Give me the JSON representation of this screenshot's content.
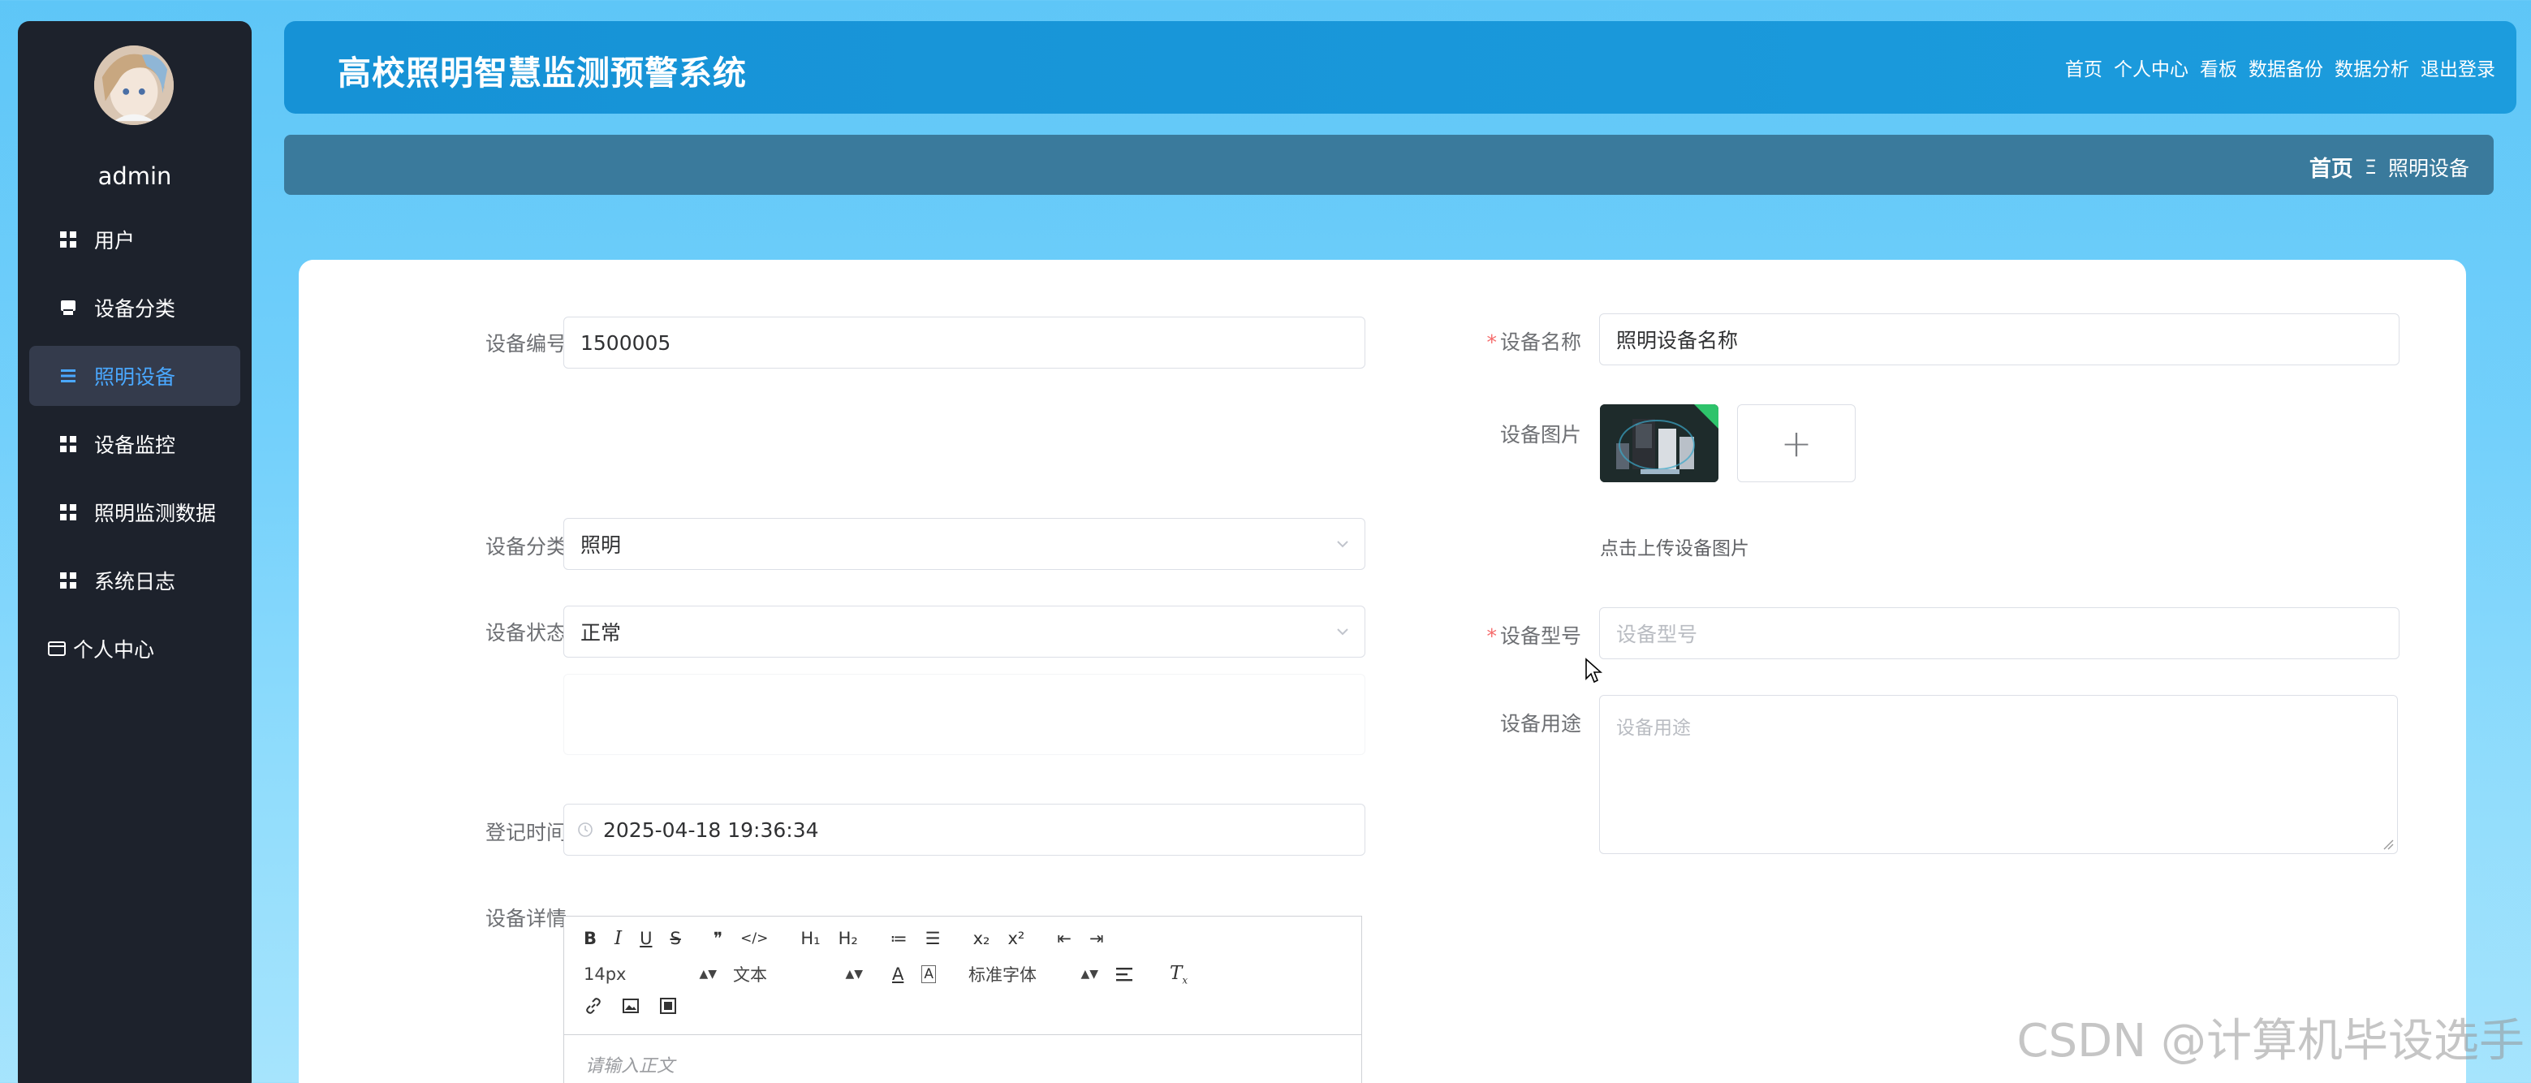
{
  "app": {
    "title": "高校照明智慧监测预警系统",
    "nav": [
      "首页",
      "个人中心",
      "看板",
      "数据备份",
      "数据分析",
      "退出登录"
    ]
  },
  "sidebar": {
    "username": "admin",
    "items": [
      {
        "label": "用户",
        "icon": "grid-icon",
        "active": false
      },
      {
        "label": "设备分类",
        "icon": "printer-icon",
        "active": false
      },
      {
        "label": "照明设备",
        "icon": "list-icon",
        "active": true
      },
      {
        "label": "设备监控",
        "icon": "grid-icon",
        "active": false
      },
      {
        "label": "照明监测数据",
        "icon": "grid-icon",
        "active": false
      },
      {
        "label": "系统日志",
        "icon": "grid-icon",
        "active": false
      },
      {
        "label": "个人中心",
        "icon": "wallet-icon",
        "active": false
      }
    ]
  },
  "breadcrumb": {
    "home": "首页",
    "separator": "Ξ",
    "current": "照明设备"
  },
  "form": {
    "device_no": {
      "label": "设备编号",
      "value": "1500005"
    },
    "device_name": {
      "label": "设备名称",
      "required_mark": "*",
      "value": "照明设备名称"
    },
    "device_image": {
      "label": "设备图片",
      "add_symbol": "+",
      "hint": "点击上传设备图片"
    },
    "device_category": {
      "label": "设备分类",
      "value": "照明"
    },
    "device_status": {
      "label": "设备状态",
      "value": "正常"
    },
    "device_model": {
      "label": "设备型号",
      "required_mark": "*",
      "placeholder": "设备型号"
    },
    "device_usage": {
      "label": "设备用途",
      "placeholder": "设备用途"
    },
    "register_time": {
      "label": "登记时间",
      "value": "2025-04-18 19:36:34"
    },
    "device_detail": {
      "label": "设备详情",
      "placeholder": "请输入正文"
    }
  },
  "editor": {
    "row1": [
      "B",
      "I",
      "U",
      "S",
      "❞",
      "</>",
      "H₁",
      "H₂",
      "≔",
      "☰",
      "x₂",
      "x²",
      "⇤",
      "⇥"
    ],
    "font_size": "14px",
    "block_type": "文本",
    "font_family": "标准字体",
    "row3_icons": [
      "link-icon",
      "image-icon",
      "video-icon"
    ]
  },
  "watermark": "CSDN @计算机毕设选手",
  "colors": {
    "accent": "#1c9cdd",
    "active_menu": "#4aa8ff",
    "sidebar": "#1d222c",
    "required": "#f56c6c"
  }
}
